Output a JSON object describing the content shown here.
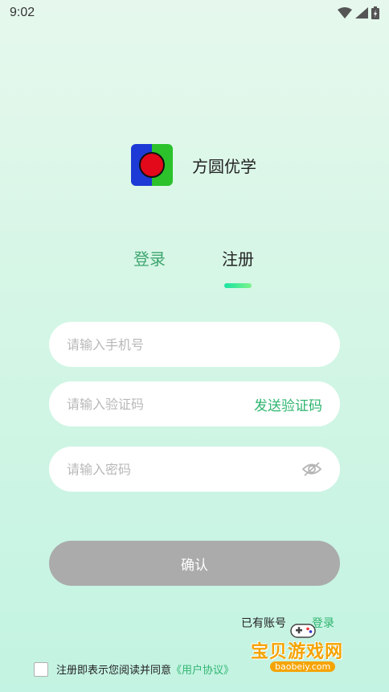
{
  "status_bar": {
    "time": "9:02"
  },
  "brand": {
    "app_name": "方圆优学"
  },
  "tabs": {
    "login": "登录",
    "register": "注册"
  },
  "form": {
    "phone_placeholder": "请输入手机号",
    "code_placeholder": "请输入验证码",
    "send_code_label": "发送验证码",
    "password_placeholder": "请输入密码",
    "confirm_label": "确认"
  },
  "footer": {
    "have_account": "已有账号",
    "login_link": "登录",
    "agreement_prefix": "注册即表示您阅读并同意",
    "user_agreement": "《用户协议》"
  },
  "watermark": {
    "title": "宝贝游戏网",
    "url": "baobeiy.com"
  },
  "colors": {
    "accent": "#2fb56f",
    "button_disabled": "#ababab"
  }
}
